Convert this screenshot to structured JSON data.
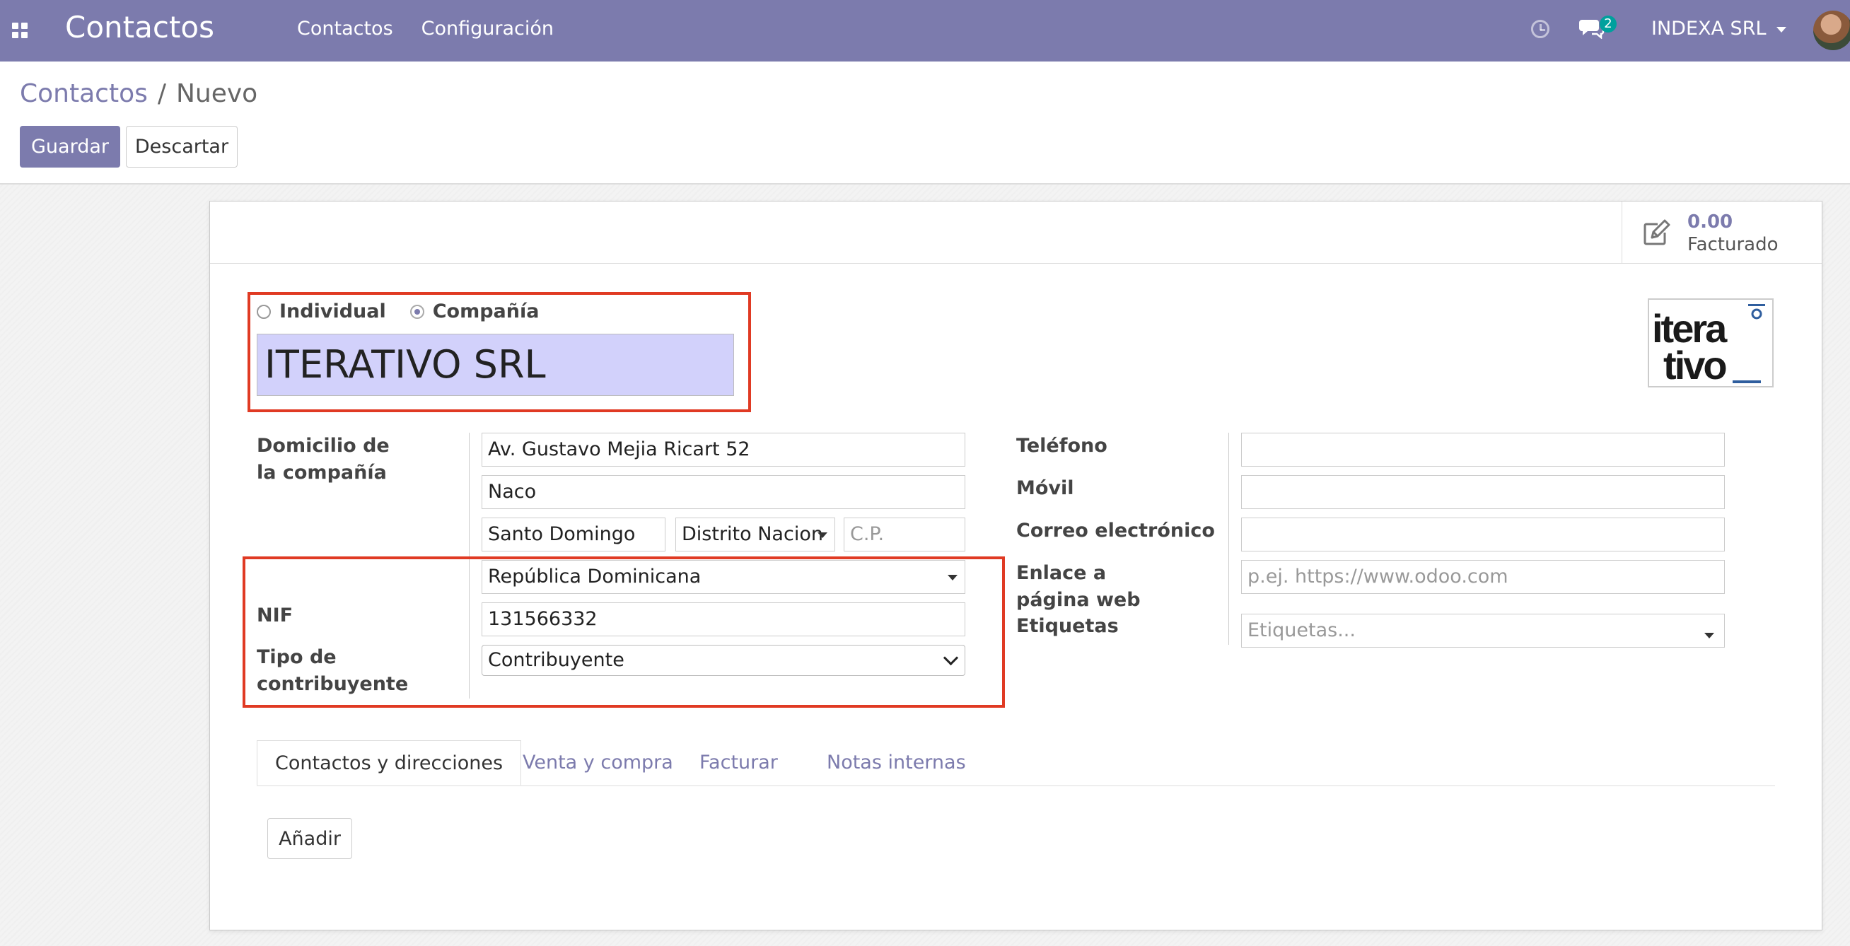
{
  "navbar": {
    "app_title": "Contactos",
    "menu": [
      "Contactos",
      "Configuración"
    ],
    "messages_badge": "2",
    "company": "INDEXA SRL",
    "color": "#7c7bad"
  },
  "control_panel": {
    "breadcrumb_parent": "Contactos",
    "breadcrumb_separator": "/",
    "breadcrumb_current": "Nuevo",
    "save_label": "Guardar",
    "discard_label": "Descartar"
  },
  "stat_button": {
    "value": "0.00",
    "label": "Facturado",
    "icon": "edit-icon"
  },
  "company_type": {
    "options": [
      "Individual",
      "Compañía"
    ],
    "selected": "Compañía"
  },
  "partner_name": "ITERATIVO SRL",
  "logo": {
    "lines": [
      "itera",
      "tivo"
    ],
    "accent": "#2f5e9e"
  },
  "left_fields": {
    "address_label": "Domicilio de la compañía",
    "street": "Av. Gustavo Mejia Ricart 52",
    "street2": "Naco",
    "city": "Santo Domingo",
    "state": "Distrito Nacion",
    "zip_placeholder": "C.P.",
    "country": "República Dominicana",
    "vat_label": "NIF",
    "vat": "131566332",
    "taxpayer_type_label": "Tipo de contribuyente",
    "taxpayer_type": "Contribuyente"
  },
  "right_fields": {
    "phone_label": "Teléfono",
    "mobile_label": "Móvil",
    "email_label": "Correo electrónico",
    "website_label": "Enlace a página web",
    "website_placeholder": "p.ej. https://www.odoo.com",
    "tags_label": "Etiquetas",
    "tags_placeholder": "Etiquetas..."
  },
  "tabs": [
    "Contactos y direcciones",
    "Venta y compra",
    "Facturar",
    "Notas internas"
  ],
  "add_button": "Añadir",
  "highlight_color": "#e03a23"
}
